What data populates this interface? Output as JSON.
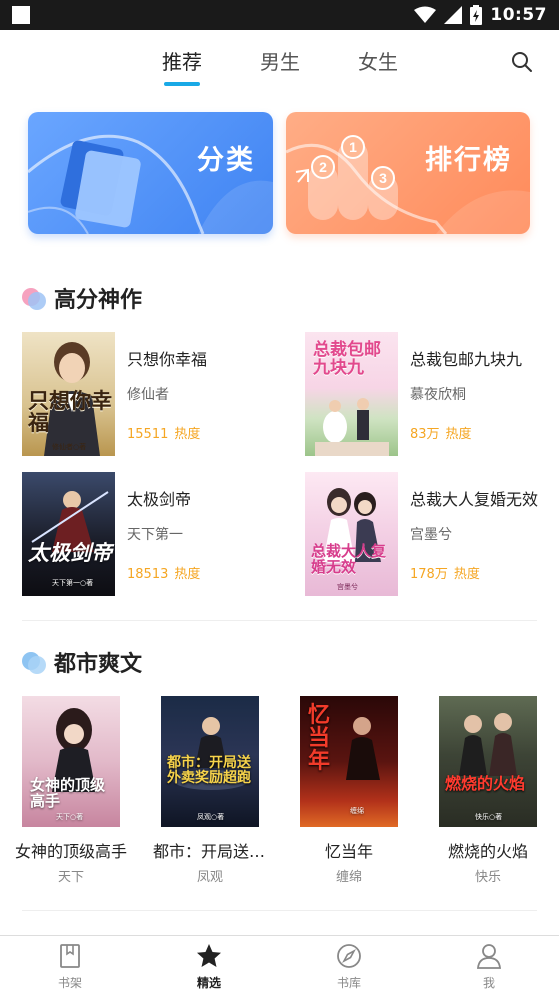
{
  "status_bar": {
    "time": "10:57"
  },
  "top_tabs": {
    "items": [
      "推荐",
      "男生",
      "女生"
    ],
    "active": "推荐"
  },
  "banners": {
    "category": "分类",
    "ranking": "排行榜",
    "rank_numbers": [
      "1",
      "2",
      "3"
    ]
  },
  "sections": [
    {
      "title": "高分神作",
      "books": [
        {
          "title": "只想你幸福",
          "author": "修仙者",
          "heat_value": "15511",
          "heat_label": "热度",
          "cover_text": "只想你幸福",
          "cover_author": "修仙者○著"
        },
        {
          "title": "总裁包邮九块九",
          "author": "慕夜欣桐",
          "heat_value": "83万",
          "heat_label": "热度",
          "cover_text": "总裁包邮九块九"
        },
        {
          "title": "太极剑帝",
          "author": "天下第一",
          "heat_value": "18513",
          "heat_label": "热度",
          "cover_text": "太极剑帝",
          "cover_author": "天下第一○著"
        },
        {
          "title": "总裁大人复婚无效",
          "author": "宫墨兮",
          "heat_value": "178万",
          "heat_label": "热度",
          "cover_text": "总裁大人复婚无效",
          "cover_author": "宫墨兮"
        }
      ]
    },
    {
      "title": "都市爽文",
      "books": [
        {
          "title": "女神的顶级高手",
          "author": "天下",
          "cover_text": "女神的顶级高手",
          "cover_author": "天下○著"
        },
        {
          "title": "都市：开局送外卖奖励超跑",
          "author": "凤观",
          "cover_text": "都市：开局送外卖奖励超跑",
          "cover_author": "凤观○著"
        },
        {
          "title": "忆当年",
          "author": "缠绵",
          "cover_text": "忆当年",
          "cover_author": "缠绵"
        },
        {
          "title": "燃烧的火焰",
          "author": "快乐",
          "cover_text": "燃烧的火焰",
          "cover_author": "快乐○著"
        }
      ]
    }
  ],
  "bottom_nav": {
    "items": [
      {
        "label": "书架",
        "icon": "bookshelf-icon"
      },
      {
        "label": "精选",
        "icon": "star-icon"
      },
      {
        "label": "书库",
        "icon": "compass-icon"
      },
      {
        "label": "我",
        "icon": "user-icon"
      }
    ],
    "active": "精选"
  },
  "colors": {
    "accent": "#19a9e6",
    "heat": "#f5a623",
    "category_banner": "#4a8ef5",
    "ranking_banner": "#ff9567"
  }
}
